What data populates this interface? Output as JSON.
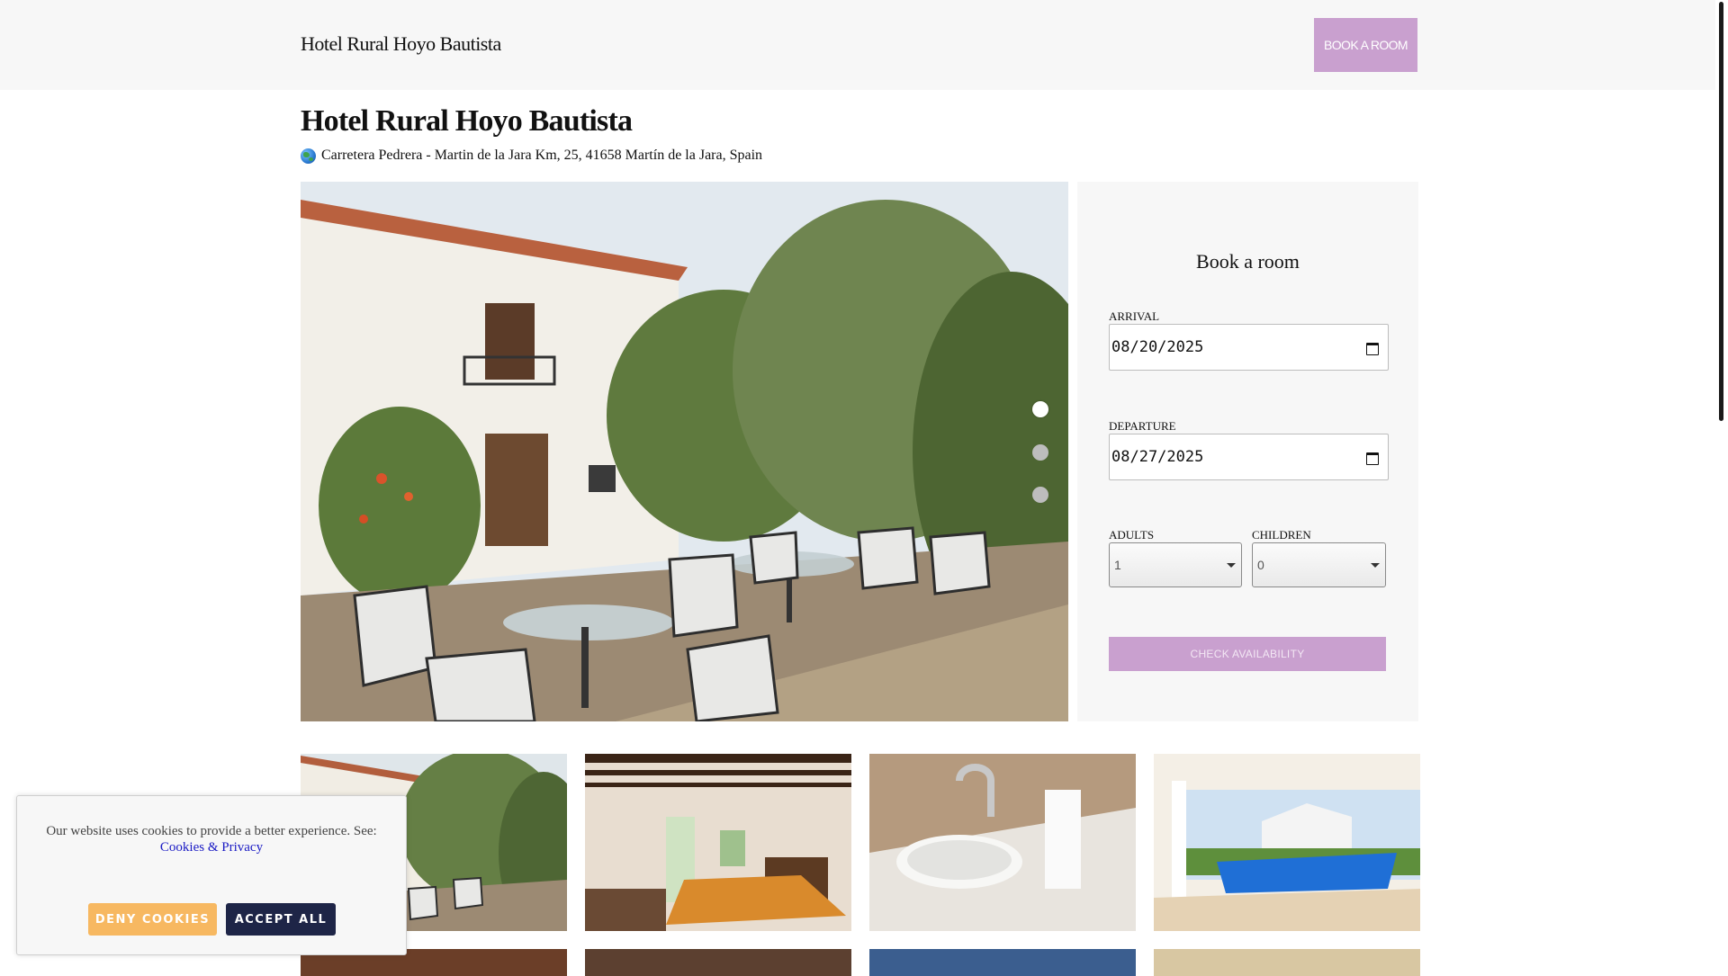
{
  "header": {
    "brand": "Hotel Rural Hoyo Bautista",
    "book_button": "BOOK A ROOM"
  },
  "hotel": {
    "name": "Hotel Rural Hoyo Bautista",
    "address": "Carretera Pedrera - Martin de la Jara Km, 25, 41658 Martín de la Jara, Spain",
    "address_icon": "globe-icon"
  },
  "carousel": {
    "slide_count": 3,
    "active_slide": 1
  },
  "booking": {
    "title": "Book a room",
    "arrival_label": "ARRIVAL",
    "arrival_value": "08/20/2025",
    "departure_label": "DEPARTURE",
    "departure_value": "08/27/2025",
    "adults_label": "ADULTS",
    "adults_value": "1",
    "children_label": "CHILDREN",
    "children_value": "0",
    "check_button": "CHECK AVAILABILITY"
  },
  "cookie_banner": {
    "message": "Our website uses cookies to provide a better experience. See:",
    "link": "Cookies & Privacy",
    "deny": "DENY COOKIES",
    "accept": "ACCEPT ALL"
  },
  "colors": {
    "accent": "#c9a0cf",
    "deny": "#f7b861",
    "accept": "#1e2547"
  }
}
